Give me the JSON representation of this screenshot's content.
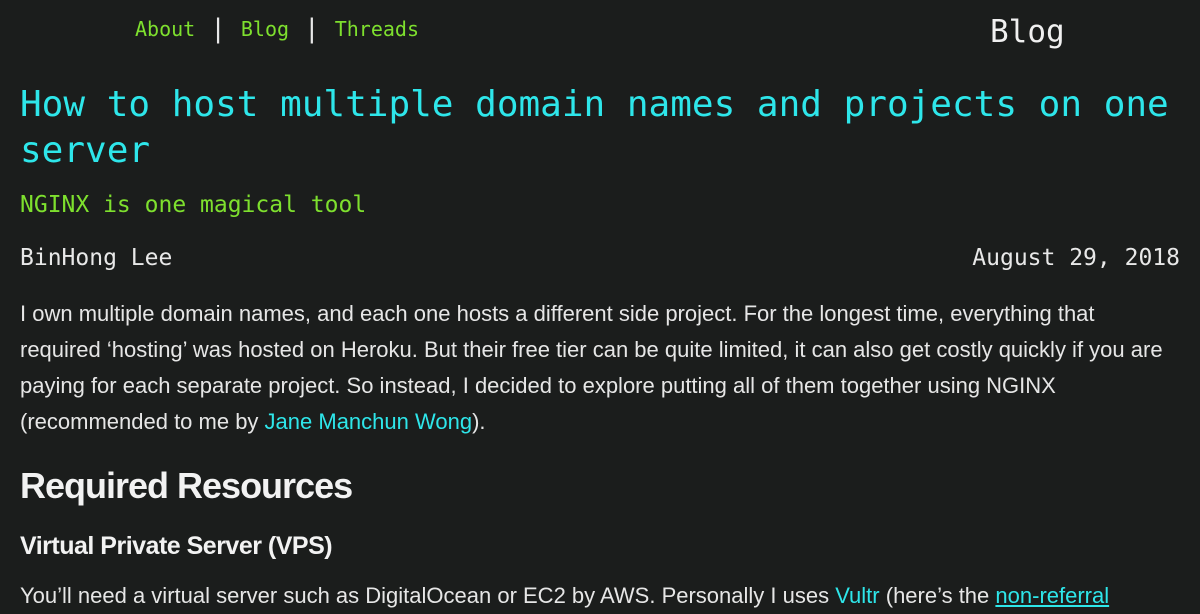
{
  "nav": {
    "items": [
      "About",
      "Blog",
      "Threads"
    ],
    "brand": "Blog"
  },
  "post": {
    "title": "How to host multiple domain names and projects on one server",
    "subtitle": "NGINX is one magical tool",
    "author": "BinHong Lee",
    "date": "August 29, 2018",
    "intro_text": "I own multiple domain names, and each one hosts a different side project. For the longest time, everything that required ‘hosting’ was hosted on Heroku. But their free tier can be quite limited, it can also get costly quickly if you are paying for each separate project. So instead, I decided to explore putting all of them together using NGINX (recommended to me by ",
    "intro_link": "Jane Manchun Wong",
    "intro_end": ").",
    "section_heading": "Required Resources",
    "subsection_heading": "Virtual Private Server (VPS)",
    "vps_text": "You’ll need a virtual server such as DigitalOcean or EC2 by AWS. Personally I uses ",
    "vps_link": "Vultr",
    "vps_mid": " (here’s the ",
    "vps_link2": "non-referral"
  },
  "colors": {
    "background": "#1b1d1c",
    "title": "#2ee6ea",
    "accent_green": "#7ee02e",
    "link": "#2ee6ea"
  }
}
